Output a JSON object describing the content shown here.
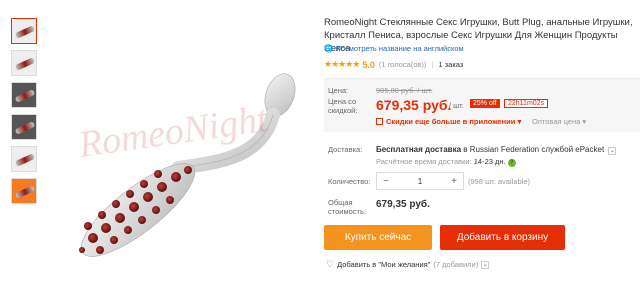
{
  "product": {
    "title": "RomeoNight Стеклянные Секс Игрушки, Butt Plug, анальные Игрушки, Кристалл Пениса, взрослые Секс Игрушки Для Женщин Продукты Секса",
    "translate_link": "Посмотреть название на английском",
    "watermark": "RomeoNight"
  },
  "rating": {
    "stars": "★★★★★",
    "score": "5.0",
    "votes": "(1 голоса(ов))",
    "orders": "1 заказ"
  },
  "price": {
    "label": "Цена:",
    "old": "905,80 руб. / шт.",
    "discount_label": "Цена со скидкой:",
    "new": "679,35 руб.",
    "per": "/ шт.",
    "off": "25% off",
    "timer": "22h11m02s",
    "app_promo": "Скидки еще больше в приложении ▾",
    "wholesale": "Оптовая цена ▾"
  },
  "shipping": {
    "label": "Доставка:",
    "method_prefix": "Бесплатная доставка",
    "method_suffix": " в Russian Federation службой ePacket",
    "time_label": "Расчётное время доставки: ",
    "time_value": "14-23 дн."
  },
  "quantity": {
    "label": "Количество:",
    "value": "1",
    "available": "(998 шт. available)"
  },
  "total": {
    "label": "Общая стоимость:",
    "value": "679,35 руб."
  },
  "actions": {
    "buy_now": "Купить сейчас",
    "add_to_cart": "Добавить в корзину",
    "wishlist": "Добавить в \"Мои желания\"",
    "wishlist_count": "(7 добавили)"
  },
  "colors": {
    "accent_red": "#e62e04",
    "buy_orange": "#f5931f",
    "link_blue": "#2266cc",
    "star_gold": "#f7a000"
  }
}
